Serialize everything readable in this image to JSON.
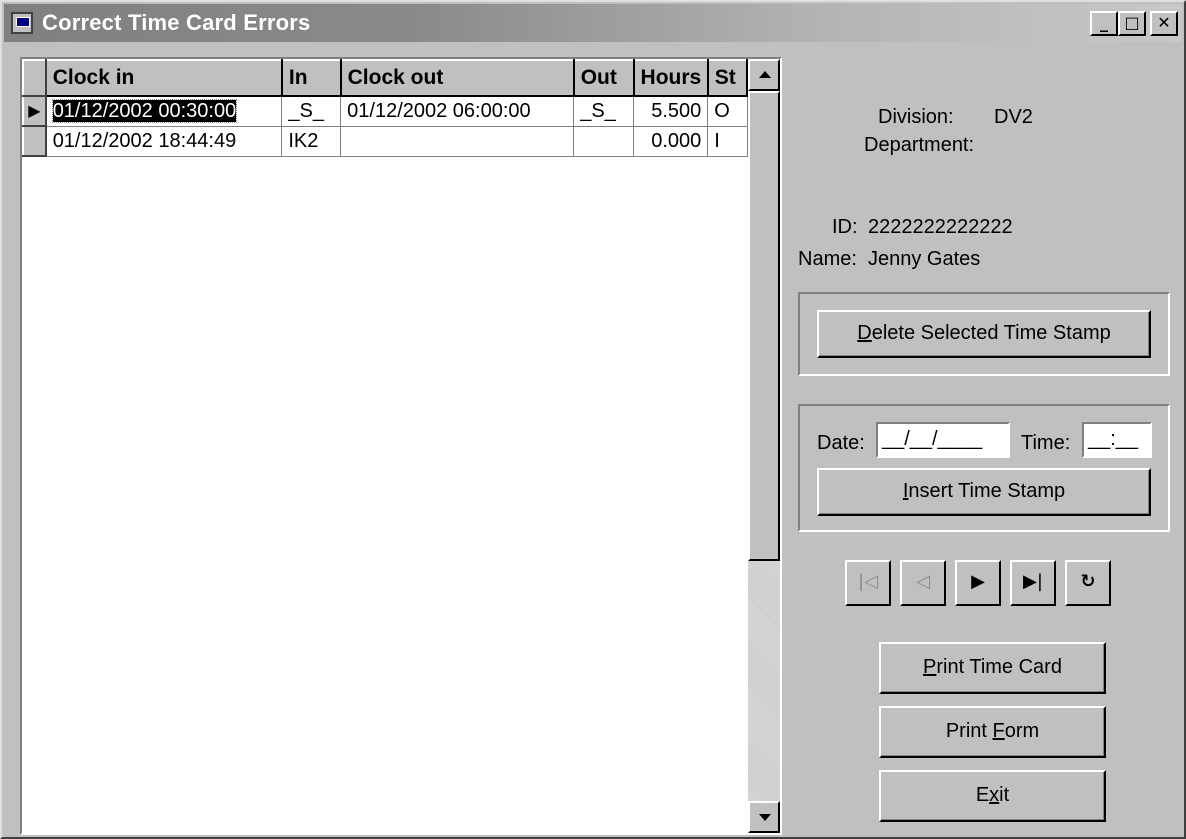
{
  "window": {
    "title": "Correct Time Card Errors",
    "minimize": "_",
    "maximize": "□",
    "close": "✕"
  },
  "grid": {
    "columns": [
      "Clock in",
      "In",
      "Clock out",
      "Out",
      "Hours",
      "St"
    ],
    "rows": [
      {
        "indicator": "▶",
        "clock_in": "01/12/2002 00:30:00",
        "in": "_S_",
        "clock_out": "01/12/2002 06:00:00",
        "out": "_S_",
        "hours": "5.500",
        "st": "O"
      },
      {
        "indicator": "",
        "clock_in": "01/12/2002 18:44:49",
        "in": "IK2",
        "clock_out": "",
        "out": "",
        "hours": "0.000",
        "st": "I"
      }
    ]
  },
  "info": {
    "division_label": "Division:",
    "division_value": "DV2",
    "department_label": "Department:",
    "department_value": "",
    "id_label": "ID:",
    "id_value": "2222222222222",
    "name_label": "Name:",
    "name_value": "Jenny Gates"
  },
  "buttons": {
    "delete_prefix": "D",
    "delete_rest": "elete Selected Time Stamp",
    "insert_prefix": "I",
    "insert_rest": "nsert Time Stamp",
    "print_card_prefix": "P",
    "print_card_rest": "rint Time Card",
    "print_form_start": "Print ",
    "print_form_mnemonic": "F",
    "print_form_rest": "orm",
    "exit_start": "E",
    "exit_mnemonic": "x",
    "exit_rest": "it"
  },
  "insert": {
    "date_label": "Date:",
    "date_value": "__/__/____",
    "time_label": "Time:",
    "time_value": "__:__"
  },
  "navigator": {
    "first": "|◁",
    "prior": "◁",
    "next": "▶",
    "last": "▶|",
    "refresh": "↻"
  }
}
